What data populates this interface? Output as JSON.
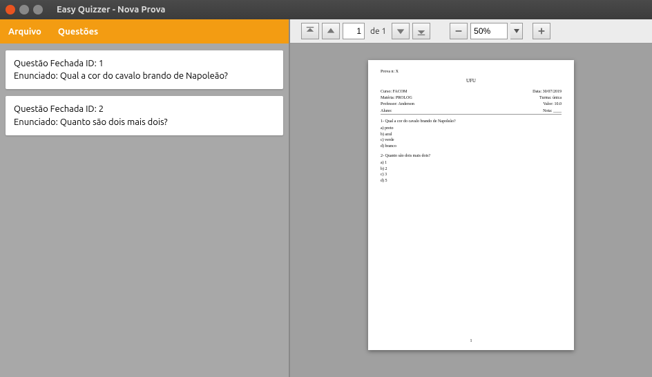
{
  "window": {
    "title": "Easy Quizzer - Nova Prova"
  },
  "menubar": {
    "file": "Arquivo",
    "questions": "Questões"
  },
  "questions": [
    {
      "id_line": "Questão Fechada ID: 1",
      "stmt_line": "Enunciado: Qual a cor do cavalo brando de Napoleão?"
    },
    {
      "id_line": "Questão Fechada ID: 2",
      "stmt_line": "Enunciado: Quanto são dois mais dois?"
    }
  ],
  "toolbar": {
    "page_input": "1",
    "page_total_label": "de 1",
    "zoom_value": "50%"
  },
  "preview": {
    "prova_label": "Prova n: X",
    "institution": "UFU",
    "curso": "Curso:  FACOM",
    "materia": "Matéria:  PROLOG",
    "professor": "Professor:  Anderson",
    "aluno_label": "Aluno:",
    "data": "Data:  30/07/2019",
    "turma": "Turma:  única",
    "valor": "Valor:  10.0",
    "nota_label": "Nota: ____",
    "q1": "1- Qual a cor do cavalo brando de Napoleão?",
    "q1_opts": [
      "a) preto",
      "b) azul",
      "c) verde",
      "d) branco"
    ],
    "q2": "2- Quanto são dois mais dois?",
    "q2_opts": [
      "a) 1",
      "b) 2",
      "c) 3",
      "d) 5"
    ],
    "page_number": "1"
  }
}
